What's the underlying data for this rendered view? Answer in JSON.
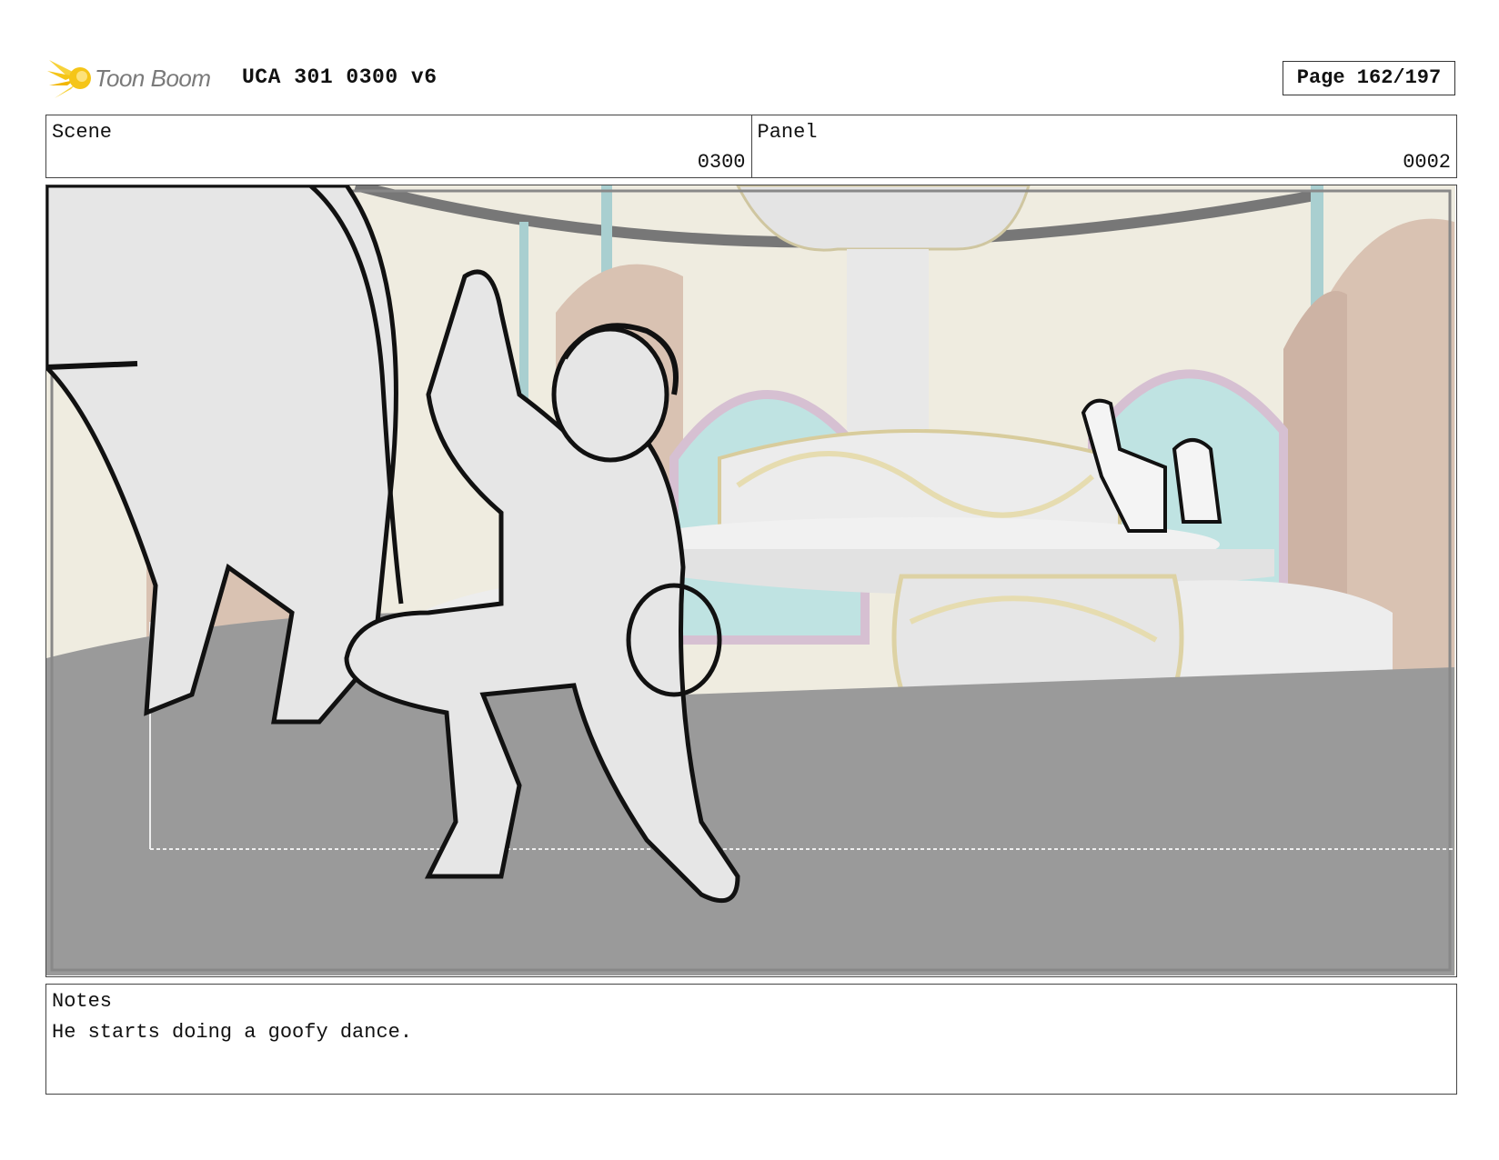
{
  "header": {
    "logo_text": "Toon Boom",
    "title": "UCA 301 0300 v6",
    "page": "Page 162/197"
  },
  "info": {
    "scene_label": "Scene",
    "scene_value": "0300",
    "panel_label": "Panel",
    "panel_value": "0002"
  },
  "notes": {
    "label": "Notes",
    "text": "He starts doing a goofy dance."
  },
  "colors": {
    "logo_accent": "#f5c518",
    "floor": "#9a9a9a",
    "wall": "#efece0",
    "window": "#bfe3e2",
    "trim": "#e6dcb0"
  }
}
